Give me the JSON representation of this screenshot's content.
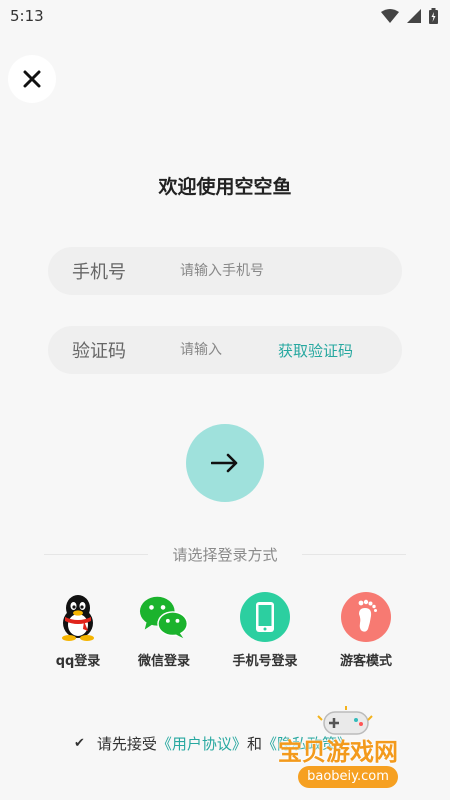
{
  "status_bar": {
    "time": "5:13"
  },
  "header": {
    "welcome": "欢迎使用空空鱼"
  },
  "phone_field": {
    "label": "手机号",
    "placeholder": "请输入手机号"
  },
  "code_field": {
    "label": "验证码",
    "placeholder": "请输入",
    "get_code": "获取验证码"
  },
  "login_methods": {
    "divider": "请选择登录方式",
    "items": [
      {
        "label": "qq登录",
        "icon": "qq-penguin-icon"
      },
      {
        "label": "微信登录",
        "icon": "wechat-icon",
        "color": "#1bb32d"
      },
      {
        "label": "手机号登录",
        "icon": "phone-icon",
        "color": "#2ccfa0"
      },
      {
        "label": "游客模式",
        "icon": "footprint-icon",
        "color": "#f77a72"
      }
    ]
  },
  "agreement": {
    "prefix": "请先接受",
    "user_agreement": "《用户协议》",
    "and": "和",
    "privacy_policy": "《隐私政策》"
  },
  "watermark": {
    "brand": "宝贝游戏网",
    "url": "baobeiy.com"
  },
  "colors": {
    "accent": "#27a8a0",
    "go_button": "#9fe1dc",
    "background": "#f7f7f7"
  }
}
